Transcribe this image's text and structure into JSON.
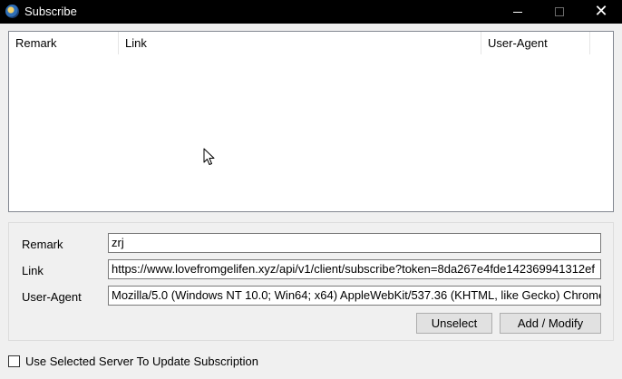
{
  "window": {
    "title": "Subscribe"
  },
  "list": {
    "columns": [
      "Remark",
      "Link",
      "User-Agent"
    ],
    "rows": []
  },
  "form": {
    "remark_label": "Remark",
    "remark_value": "zrj",
    "link_label": "Link",
    "link_value": "https://www.lovefromgelifen.xyz/api/v1/client/subscribe?token=8da267e4fde142369941312ef",
    "ua_label": "User-Agent",
    "ua_value": "Mozilla/5.0 (Windows NT 10.0; Win64; x64) AppleWebKit/537.36 (KHTML, like Gecko) Chrome"
  },
  "buttons": {
    "unselect": "Unselect",
    "add_modify": "Add / Modify"
  },
  "options": {
    "use_selected_server_label": "Use Selected Server To Update Subscription",
    "use_selected_server_checked": false
  },
  "icons": {
    "app": "v2ray-app-icon",
    "minimize": "minimize-icon",
    "maximize": "maximize-icon",
    "close": "close-icon",
    "cursor": "mouse-pointer-icon"
  }
}
